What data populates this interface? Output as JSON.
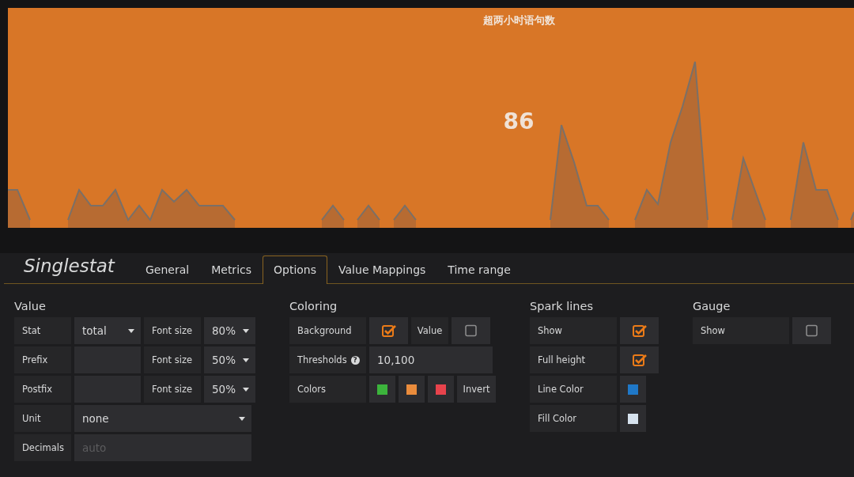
{
  "panel": {
    "title": "超两小时语句数",
    "value": "86"
  },
  "editor": {
    "title": "Singlestat",
    "tabs": [
      {
        "label": "General",
        "selected": false
      },
      {
        "label": "Metrics",
        "selected": false
      },
      {
        "label": "Options",
        "selected": true
      },
      {
        "label": "Value Mappings",
        "selected": false
      },
      {
        "label": "Time range",
        "selected": false
      }
    ]
  },
  "sections": [
    {
      "heading": "Value",
      "rows": [
        {
          "cells": [
            {
              "kind": "label",
              "text": "Stat"
            },
            {
              "kind": "select",
              "value": "total"
            },
            {
              "kind": "label",
              "text": "Font size"
            },
            {
              "kind": "select",
              "value": "80%"
            }
          ]
        },
        {
          "cells": [
            {
              "kind": "label",
              "text": "Prefix"
            },
            {
              "kind": "input"
            },
            {
              "kind": "label",
              "text": "Font size"
            },
            {
              "kind": "select",
              "value": "50%"
            }
          ]
        },
        {
          "cells": [
            {
              "kind": "label",
              "text": "Postfix"
            },
            {
              "kind": "input"
            },
            {
              "kind": "label",
              "text": "Font size"
            },
            {
              "kind": "select",
              "value": "50%"
            }
          ]
        },
        {
          "cells": [
            {
              "kind": "label",
              "text": "Unit"
            },
            {
              "kind": "select",
              "value": "none"
            }
          ]
        },
        {
          "cells": [
            {
              "kind": "label",
              "text": "Decimals"
            },
            {
              "kind": "input",
              "placeholder": "auto"
            }
          ]
        }
      ]
    },
    {
      "heading": "Coloring",
      "rows": [
        {
          "cells": [
            {
              "kind": "label",
              "text": "Background"
            },
            {
              "kind": "checkbox",
              "checked": true
            },
            {
              "kind": "label",
              "text": "Value"
            },
            {
              "kind": "checkbox",
              "checked": false
            }
          ]
        },
        {
          "cells": [
            {
              "kind": "label",
              "text": "Thresholds",
              "help": "?"
            },
            {
              "kind": "input",
              "value": "10,100"
            }
          ]
        },
        {
          "cells": [
            {
              "kind": "label",
              "text": "Colors"
            },
            {
              "kind": "swatch",
              "color": "#3cb43c"
            },
            {
              "kind": "swatch",
              "color": "#ea8c3c"
            },
            {
              "kind": "swatch",
              "color": "#e8434c"
            },
            {
              "kind": "button",
              "text": "Invert"
            }
          ]
        }
      ]
    },
    {
      "heading": "Spark lines",
      "rows": [
        {
          "cells": [
            {
              "kind": "label",
              "text": "Show"
            },
            {
              "kind": "checkbox",
              "checked": true
            }
          ]
        },
        {
          "cells": [
            {
              "kind": "label",
              "text": "Full height"
            },
            {
              "kind": "checkbox",
              "checked": true
            }
          ]
        },
        {
          "cells": [
            {
              "kind": "label",
              "text": "Line Color"
            },
            {
              "kind": "swatch",
              "color": "#1f78c8"
            }
          ]
        },
        {
          "cells": [
            {
              "kind": "label",
              "text": "Fill Color"
            },
            {
              "kind": "swatch",
              "color": "#d6e2ee"
            }
          ]
        }
      ]
    },
    {
      "heading": "Gauge",
      "rows": [
        {
          "cells": [
            {
              "kind": "label",
              "text": "Show"
            },
            {
              "kind": "checkbox",
              "checked": false
            }
          ]
        }
      ]
    }
  ]
}
